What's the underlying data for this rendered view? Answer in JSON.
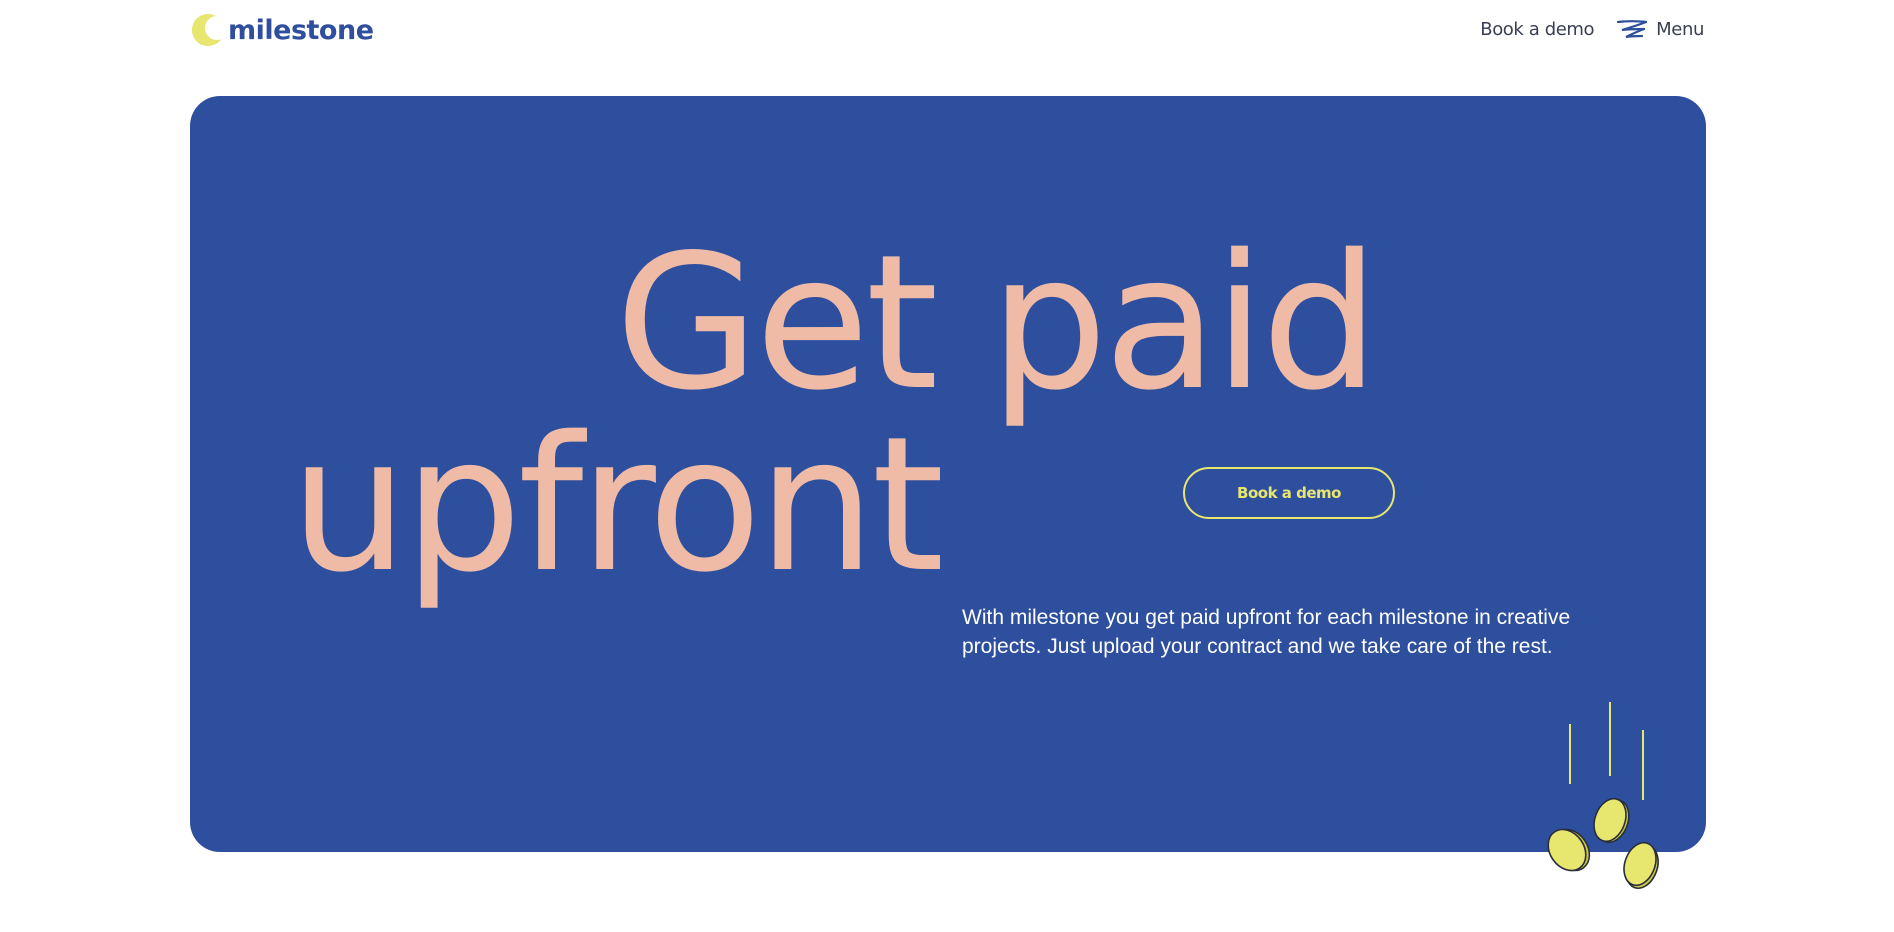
{
  "brand": {
    "name": "milestone",
    "logo_icon": "crescent-moon-icon",
    "accent_color": "#e7e66f",
    "primary_color": "#2e4f9e",
    "headline_color": "#efbba6"
  },
  "nav": {
    "book_demo_label": "Book a demo",
    "menu_label": "Menu",
    "menu_icon": "menu-lines-icon"
  },
  "hero": {
    "headline_line1": "Get paid",
    "headline_line2": "upfront",
    "cta_label": "Book a demo",
    "description": "With milestone you get paid upfront for each milestone in creative projects. Just upload your contract and we take care of the rest.",
    "illustration": "falling-coins-illustration"
  }
}
